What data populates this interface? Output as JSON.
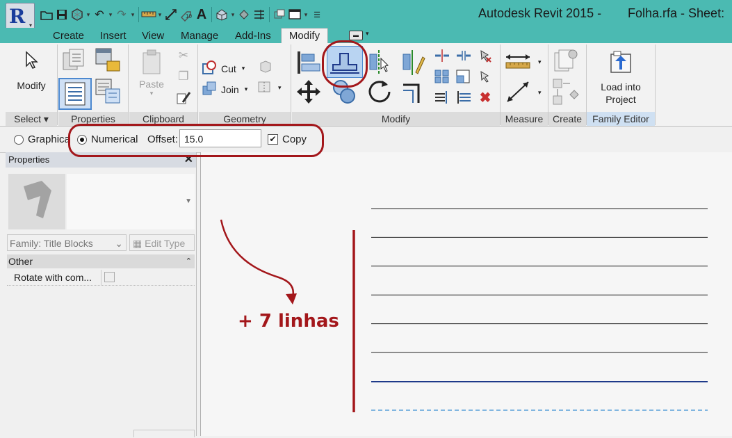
{
  "app": {
    "title": "Autodesk Revit 2015 -",
    "file": "Folha.rfa - Sheet:",
    "logo_letter": "R"
  },
  "tabs": [
    "Create",
    "Insert",
    "View",
    "Manage",
    "Add-Ins",
    "Modify"
  ],
  "active_tab": "Modify",
  "ribbon": {
    "select": {
      "button_label": "Modify",
      "panel_label": "Select"
    },
    "properties": {
      "panel_label": "Properties"
    },
    "clipboard": {
      "paste_label": "Paste",
      "panel_label": "Clipboard"
    },
    "geometry": {
      "cut_label": "Cut",
      "join_label": "Join",
      "panel_label": "Geometry"
    },
    "modify": {
      "panel_label": "Modify"
    },
    "measure": {
      "panel_label": "Measure"
    },
    "create": {
      "panel_label": "Create"
    },
    "family_editor": {
      "button_label_1": "Load into",
      "button_label_2": "Project",
      "panel_label": "Family Editor"
    }
  },
  "options_bar": {
    "graphical_label": "Graphica",
    "numerical_label": "Numerical",
    "offset_label": "Offset:",
    "offset_value": "15.0",
    "copy_label": "Copy",
    "numerical_selected": true,
    "copy_checked": true
  },
  "properties_palette": {
    "title": "Properties",
    "family_selector": "Family: Title Blocks",
    "edit_type_label": "Edit Type",
    "group_other": "Other",
    "row_rotate": "Rotate with com..."
  },
  "canvas": {
    "annotation_text": "+ 7 linhas",
    "line_count": 6
  },
  "colors": {
    "titlebar": "#4bbab2",
    "annotation": "#a3171b",
    "selected_line": "#1f3a8a",
    "accent_blue": "#3b6da8"
  },
  "icons": [
    "open-icon",
    "save-icon",
    "sync-icon",
    "undo-icon",
    "redo-icon",
    "measure-icon",
    "dimension-icon",
    "tag-icon",
    "text-icon",
    "3d-view-icon",
    "section-icon",
    "thin-lines-icon",
    "close-hidden-icon",
    "switch-windows-icon",
    "customize-icon"
  ]
}
